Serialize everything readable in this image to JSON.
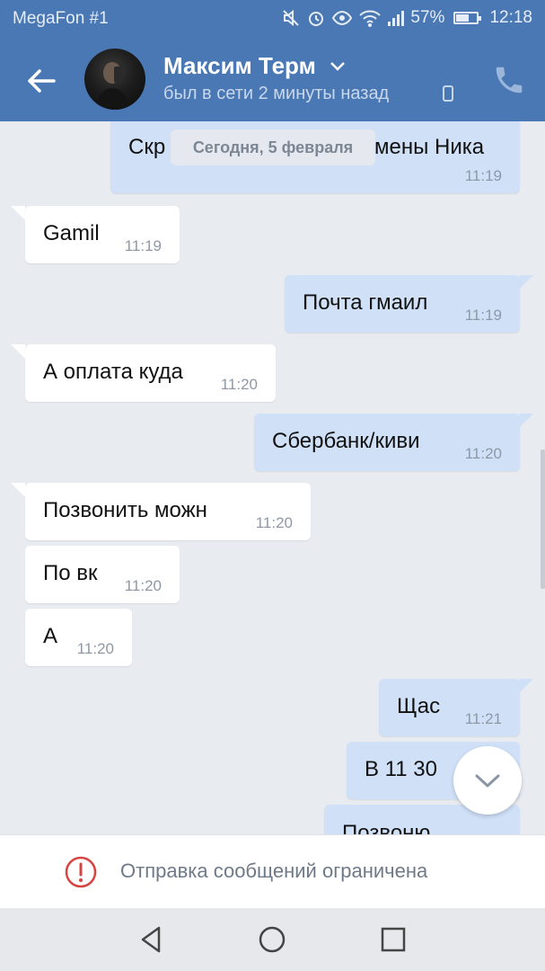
{
  "status_bar": {
    "carrier": "MegaFon #1",
    "battery": "57%",
    "time": "12:18",
    "icons": [
      "mute-icon",
      "alarm-icon",
      "eye-icon",
      "wifi-icon",
      "signal-icon",
      "battery-icon"
    ]
  },
  "header": {
    "contact_name": "Максим Терм",
    "contact_status": "был в сети 2 минуты назад",
    "icons": [
      "back-arrow-icon",
      "chevron-down-icon",
      "mobile-phone-icon",
      "call-icon"
    ]
  },
  "chat": {
    "date_badge": "Сегодня, 5 февраля",
    "top_message": {
      "text_left": "Скр",
      "text_right": "мены Ника",
      "time": "11:19"
    },
    "messages": [
      {
        "direction": "in",
        "text": "Gamil",
        "time": "11:19"
      },
      {
        "direction": "out",
        "text": "Почта гмаил",
        "time": "11:19"
      },
      {
        "direction": "in",
        "text": "А оплата куда",
        "time": "11:20"
      },
      {
        "direction": "out",
        "text": "Сбербанк/киви",
        "time": "11:20"
      },
      {
        "direction": "in",
        "text": "Позвонить можн",
        "time": "11:20"
      },
      {
        "direction": "in",
        "text": "По вк",
        "time": "11:20"
      },
      {
        "direction": "in",
        "text": "А",
        "time": "11:20"
      },
      {
        "direction": "out",
        "text": "Щас",
        "time": "11:21"
      },
      {
        "direction": "out",
        "text": "В 11 30",
        "time": ""
      },
      {
        "direction": "out",
        "text": "Позвоню",
        "time": ""
      }
    ]
  },
  "restriction": {
    "text": "Отправка сообщений ограничена"
  },
  "colors": {
    "header": "#4a78b5",
    "incoming": "#ffffff",
    "outgoing": "#cfe0f7",
    "background": "#e8ebf0",
    "warning": "#d64541"
  }
}
